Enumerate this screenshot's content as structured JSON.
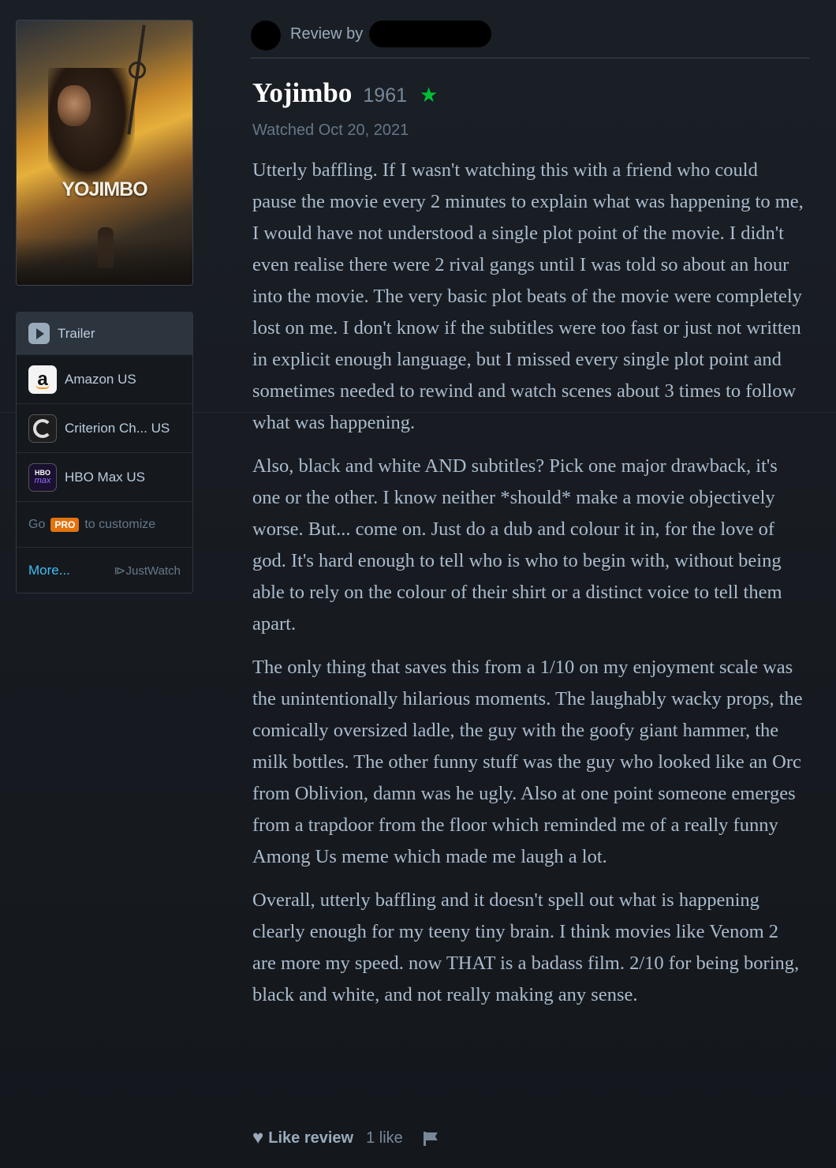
{
  "poster": {
    "title_text": "YOJIMBO"
  },
  "where_to_watch": {
    "trailer_label": "Trailer",
    "services": [
      {
        "name": "Amazon US",
        "icon": "amazon-icon"
      },
      {
        "name": "Criterion Ch... US",
        "icon": "criterion-icon"
      },
      {
        "name": "HBO Max US",
        "icon": "hbo-max-icon"
      }
    ],
    "go_prefix": "Go",
    "pro_badge": "PRO",
    "go_suffix": "to customize",
    "more_label": "More...",
    "provider_credit": "JustWatch",
    "hbo_icon_top": "HBO",
    "hbo_icon_bottom": "max",
    "amazon_icon_letter": "a"
  },
  "review": {
    "by_label": "Review by",
    "film_title": "Yojimbo",
    "film_year": "1961",
    "rating_stars": 1,
    "star_glyph": "★",
    "star_color": "#00c030",
    "watched_label": "Watched Oct 20, 2021",
    "paragraphs": [
      "Utterly baffling. If I wasn't watching this with a friend who could pause the movie every 2 minutes to explain what was happening to me, I would have not understood a single plot point of the movie. I didn't even realise there were 2 rival gangs until I was told so about an hour into the movie. The very basic plot beats of the movie were completely lost on me. I don't know if the subtitles were too fast or just not written in explicit enough language, but I missed every single plot point and sometimes needed to rewind and watch scenes about 3 times to follow what was happening.",
      "Also, black and white AND subtitles? Pick one major drawback, it's one or the other. I know neither *should* make a movie objectively worse. But... come on. Just do a dub and colour it in, for the love of god. It's hard enough to tell who is who to begin with, without being able to rely on the colour of their shirt or a distinct voice to tell them apart.",
      "The only thing that saves this from a 1/10 on my enjoyment scale was the unintentionally hilarious moments. The laughably wacky props, the comically oversized ladle, the guy with the goofy giant hammer, the milk bottles. The other funny stuff was the guy who looked like an Orc from Oblivion, damn was he ugly. Also at one point someone emerges from a trapdoor from the floor which reminded me of a really funny Among Us meme which made me laugh a lot.",
      "Overall, utterly baffling and it doesn't spell out what is happening clearly enough for my teeny tiny brain. I think movies like Venom 2 are more my speed. now THAT is a badass film. 2/10 for being boring, black and white, and not really making any sense."
    ],
    "like_label": "Like review",
    "like_count": "1 like"
  },
  "colors": {
    "accent_link": "#40bcf4",
    "pro_badge": "#e3730e"
  }
}
